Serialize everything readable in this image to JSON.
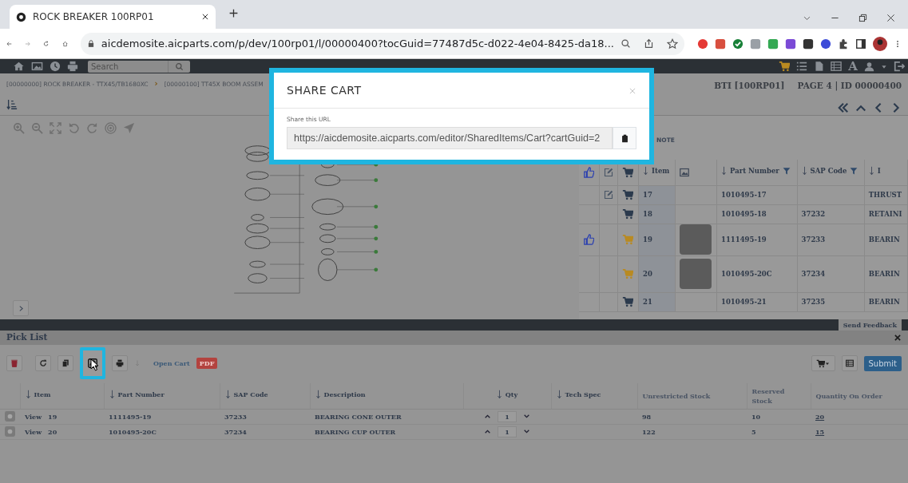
{
  "browser": {
    "tab_title": "ROCK BREAKER 100RP01",
    "url": "aicdemosite.aicparts.com/p/dev/100rp01/l/00000400?tocGuid=77487d5c-d022-4e04-8425-da18..."
  },
  "navbar": {
    "search": {
      "placeholder": "Search"
    },
    "font_button": "A"
  },
  "breadcrumb": {
    "items": [
      "[00000000] ROCK BREAKER - TTX45/TB1680XC",
      "[00000100] TT45X BOOM ASSEM"
    ],
    "separator": "›"
  },
  "page_info": {
    "book": "BTI [100RP01]",
    "page": "PAGE 4 | ID 00000400"
  },
  "parts_panel": {
    "note_label": "NOTE",
    "columns": [
      {
        "kind": "like"
      },
      {
        "kind": "edit"
      },
      {
        "kind": "cart"
      },
      {
        "kind": "text",
        "label": "Item",
        "filter": false
      },
      {
        "kind": "image"
      },
      {
        "kind": "text",
        "label": "Part Number",
        "filter": true
      },
      {
        "kind": "text",
        "label": "SAP Code",
        "filter": true
      },
      {
        "kind": "text",
        "label": "I",
        "filter": false
      }
    ],
    "rows": [
      {
        "liked": false,
        "editable": true,
        "in_cart": false,
        "photo": false,
        "item": "17",
        "part_number": "1010495-17",
        "sap_code": "",
        "description": "THRUST"
      },
      {
        "liked": false,
        "editable": false,
        "in_cart": false,
        "photo": false,
        "item": "18",
        "part_number": "1010495-18",
        "sap_code": "37232",
        "description": "RETAINI"
      },
      {
        "liked": true,
        "editable": false,
        "in_cart": true,
        "photo": true,
        "item": "19",
        "part_number": "1111495-19",
        "sap_code": "37233",
        "description": "BEARIN"
      },
      {
        "liked": false,
        "editable": false,
        "in_cart": true,
        "photo": true,
        "item": "20",
        "part_number": "1010495-20C",
        "sap_code": "37234",
        "description": "BEARIN"
      },
      {
        "liked": false,
        "editable": false,
        "in_cart": false,
        "photo": false,
        "item": "21",
        "part_number": "1010495-21",
        "sap_code": "37235",
        "description": "BEARIN"
      }
    ]
  },
  "feedback_button": "Send Feedback",
  "pick_list": {
    "title": "Pick List",
    "share_highlighted": true,
    "open_cart": "Open Cart",
    "pdf_badge": "PDF",
    "submit": "Submit",
    "columns": [
      {
        "label": "Item",
        "sortable": true
      },
      {
        "label": "Part Number",
        "sortable": true
      },
      {
        "label": "SAP Code",
        "sortable": true
      },
      {
        "label": "Description",
        "sortable": true
      },
      {
        "label": "Qty",
        "sortable": true
      },
      {
        "label": "Tech Spec",
        "sortable": true
      },
      {
        "label": "Unrestricted Stock",
        "sortable": false
      },
      {
        "label": "Reserved Stock",
        "sortable": false
      },
      {
        "label": "Quantity On Order",
        "sortable": false
      }
    ],
    "rows": [
      {
        "view": "View",
        "item": "19",
        "part_number": "1111495-19",
        "sap_code": "37233",
        "description": "BEARING CONE OUTER",
        "qty": "1",
        "unrestricted": "98",
        "reserved": "10",
        "on_order": "20"
      },
      {
        "view": "View",
        "item": "20",
        "part_number": "1010495-20C",
        "sap_code": "37234",
        "description": "BEARING CUP OUTER",
        "qty": "1",
        "unrestricted": "122",
        "reserved": "5",
        "on_order": "15"
      }
    ]
  },
  "modal": {
    "title": "SHARE CART",
    "field_label": "Share this URL",
    "url": "https://aicdemosite.aicparts.com/editor/SharedItems/Cart?cartGuid=2"
  }
}
